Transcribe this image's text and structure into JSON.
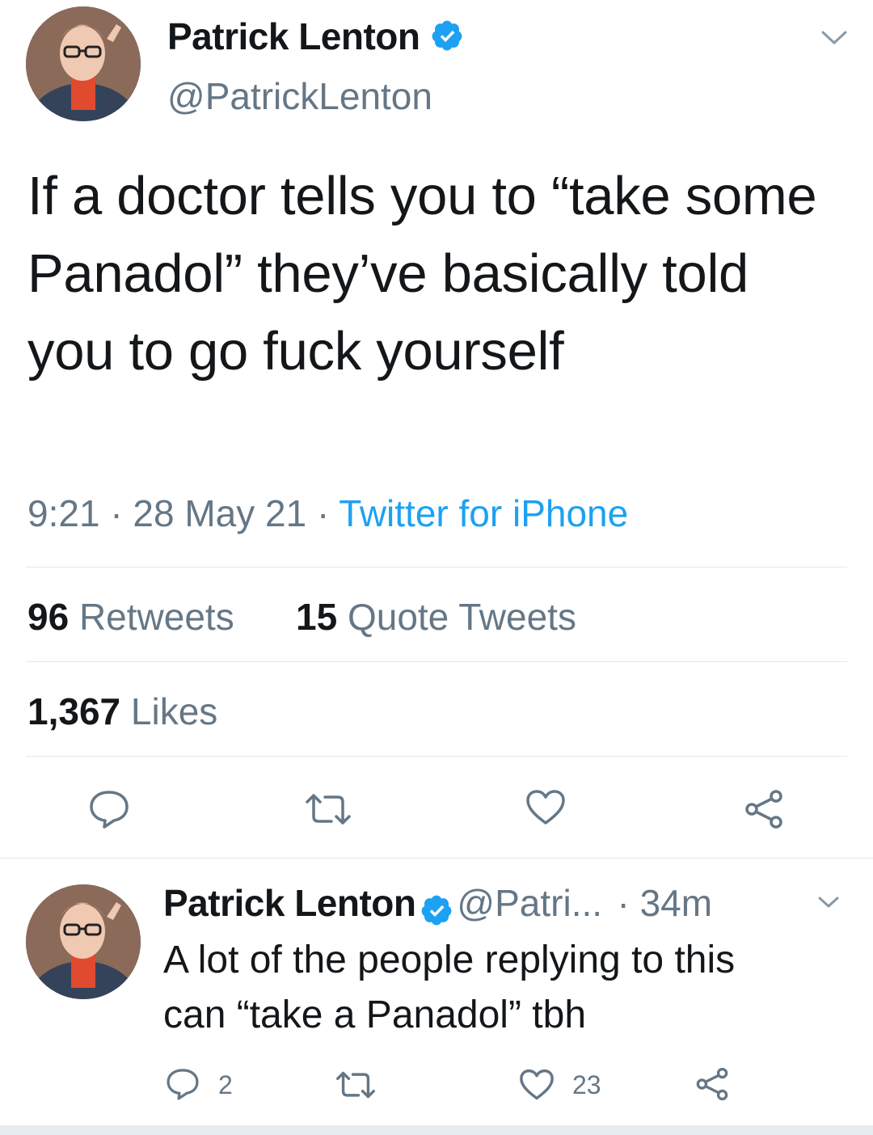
{
  "tweet": {
    "author_name": "Patrick Lenton",
    "author_handle": "@PatrickLenton",
    "text": "If a doctor tells you to “take some Panadol” they’ve basically told you to go fuck yourself",
    "time": "9:21",
    "date": "28 May 21",
    "source": "Twitter for iPhone",
    "separator": "·",
    "retweets_count": "96",
    "retweets_label": "Retweets",
    "quotes_count": "15",
    "quotes_label": "Quote Tweets",
    "likes_count": "1,367",
    "likes_label": "Likes"
  },
  "reply": {
    "author_name": "Patrick Lenton",
    "author_handle": "@Patri...",
    "age": "· 34m",
    "text_line1": "A lot of the people replying to this",
    "text_line2": "can “take a Panadol” tbh",
    "reply_count": "2",
    "like_count": "23"
  },
  "icons": {
    "verified": "verified-badge-icon",
    "more": "chevron-down-icon",
    "reply": "reply-icon",
    "retweet": "retweet-icon",
    "like": "heart-icon",
    "share": "share-icon"
  },
  "colors": {
    "accent": "#1da1f2",
    "text": "#14171a",
    "secondary": "#657786",
    "divider": "#e1e8ed"
  }
}
